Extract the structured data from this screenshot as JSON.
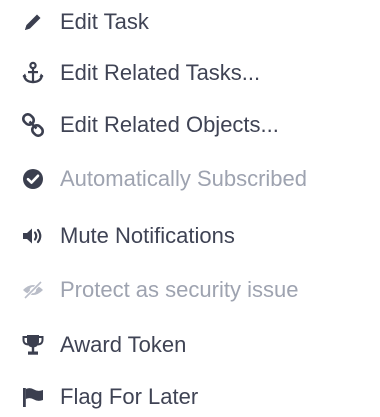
{
  "colors": {
    "text": "#3f4354",
    "icon": "#3b3f4f",
    "disabled_text": "#9ea3b0",
    "disabled_icon": "#b9bdc8"
  },
  "actions": [
    {
      "label": "Edit Task",
      "icon": "pencil-icon",
      "enabled": true
    },
    {
      "label": "Edit Related Tasks...",
      "icon": "anchor-icon",
      "enabled": true
    },
    {
      "label": "Edit Related Objects...",
      "icon": "link-icon",
      "enabled": true
    },
    {
      "label": "Automatically Subscribed",
      "icon": "check-circle-icon",
      "enabled": false
    },
    {
      "label": "Mute Notifications",
      "icon": "volume-icon",
      "enabled": true
    },
    {
      "label": "Protect as security issue",
      "icon": "eye-slash-icon",
      "enabled": false
    },
    {
      "label": "Award Token",
      "icon": "trophy-icon",
      "enabled": true
    },
    {
      "label": "Flag For Later",
      "icon": "flag-icon",
      "enabled": true
    }
  ]
}
